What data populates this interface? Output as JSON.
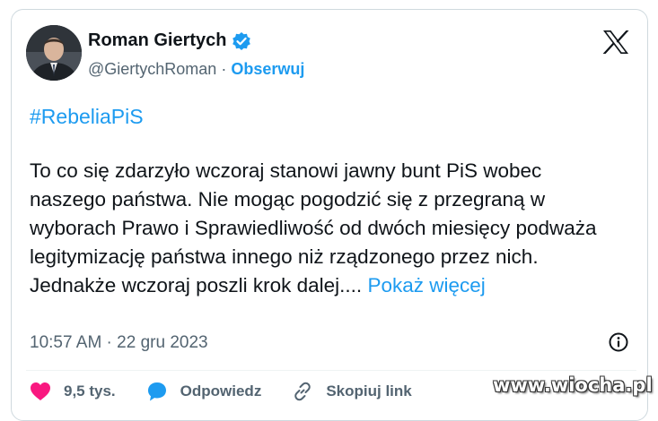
{
  "author": {
    "display_name": "Roman Giertych",
    "handle": "@GiertychRoman",
    "separator": "·",
    "follow_label": "Obserwuj",
    "verified_icon": "verified-badge-icon",
    "avatar_icon": "avatar"
  },
  "platform_logo": "x-logo-icon",
  "tweet": {
    "hashtag": "#RebeliaPiS",
    "body": "To co się zdarzyło wczoraj stanowi jawny bunt PiS wobec naszego państwa. Nie mogąc pogodzić się z przegraną w wyborach Prawo i Sprawiedliwość od dwóch miesięcy podważa legitymizację państwa innego niż rządzonego przez nich. Jednakże wczoraj poszli krok dalej....",
    "show_more_label": "Pokaż więcej",
    "timestamp": "10:57 AM · 22 gru 2023"
  },
  "actions": {
    "like_count": "9,5 tys.",
    "reply_label": "Odpowiedz",
    "copy_link_label": "Skopiuj link"
  },
  "watermark": "www.wiocha.pl",
  "colors": {
    "accent": "#1d9bf0",
    "like": "#f91880",
    "text": "#0f1419",
    "muted": "#536471",
    "border": "#cfd9de"
  }
}
